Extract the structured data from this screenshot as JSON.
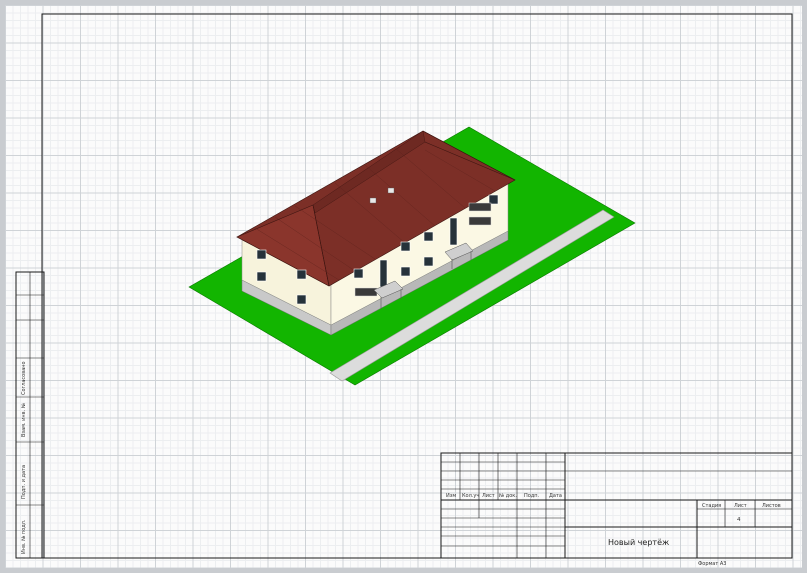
{
  "drawing": {
    "title": "Новый чертёж",
    "format": "Формат А3",
    "sheet_number": "4"
  },
  "title_block": {
    "col_headers": [
      "Изм",
      "Кол.уч",
      "Лист",
      "№ док.",
      "Подп.",
      "Дата"
    ],
    "stage_label": "Стадия",
    "sheet_label": "Лист",
    "sheets_label": "Листов"
  },
  "side_stamp": {
    "labels": [
      "Согласовано",
      "Взам. инв. №",
      "Подп. и дата",
      "Инв. № подл."
    ]
  },
  "colors": {
    "grass": "#12b500",
    "roof": "#7c2f27",
    "wall": "#fbf8e4",
    "plinth": "#c9c9c9",
    "path": "#dcdcdc"
  }
}
